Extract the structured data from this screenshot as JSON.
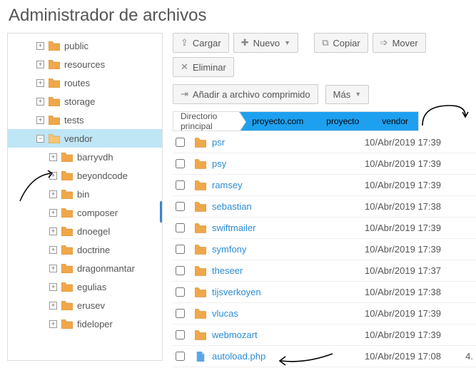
{
  "title": "Administrador de archivos",
  "toolbar": {
    "upload": "Cargar",
    "new": "Nuevo",
    "copy": "Copiar",
    "move": "Mover",
    "delete": "Eliminar",
    "compress": "Añadir a archivo comprimido",
    "more": "Más"
  },
  "breadcrumb": {
    "root": "Directorio principal",
    "segs": [
      "proyecto.com",
      "proyecto",
      "vendor"
    ]
  },
  "tree": [
    {
      "label": "public",
      "depth": 2,
      "expandable": true,
      "open": false,
      "selected": false
    },
    {
      "label": "resources",
      "depth": 2,
      "expandable": true,
      "open": false,
      "selected": false
    },
    {
      "label": "routes",
      "depth": 2,
      "expandable": true,
      "open": false,
      "selected": false
    },
    {
      "label": "storage",
      "depth": 2,
      "expandable": true,
      "open": false,
      "selected": false
    },
    {
      "label": "tests",
      "depth": 2,
      "expandable": true,
      "open": false,
      "selected": false
    },
    {
      "label": "vendor",
      "depth": 2,
      "expandable": true,
      "open": true,
      "selected": true
    },
    {
      "label": "barryvdh",
      "depth": 3,
      "expandable": true,
      "open": false,
      "selected": false
    },
    {
      "label": "beyondcode",
      "depth": 3,
      "expandable": true,
      "open": false,
      "selected": false
    },
    {
      "label": "bin",
      "depth": 3,
      "expandable": true,
      "open": false,
      "selected": false
    },
    {
      "label": "composer",
      "depth": 3,
      "expandable": true,
      "open": false,
      "selected": false
    },
    {
      "label": "dnoegel",
      "depth": 3,
      "expandable": true,
      "open": false,
      "selected": false
    },
    {
      "label": "doctrine",
      "depth": 3,
      "expandable": true,
      "open": false,
      "selected": false
    },
    {
      "label": "dragonmantar",
      "depth": 3,
      "expandable": true,
      "open": false,
      "selected": false
    },
    {
      "label": "egulias",
      "depth": 3,
      "expandable": true,
      "open": false,
      "selected": false
    },
    {
      "label": "erusev",
      "depth": 3,
      "expandable": true,
      "open": false,
      "selected": false
    },
    {
      "label": "fideloper",
      "depth": 3,
      "expandable": true,
      "open": false,
      "selected": false
    }
  ],
  "files": [
    {
      "name": "psr",
      "type": "folder",
      "date": "10/Abr/2019 17:39",
      "size": ""
    },
    {
      "name": "psy",
      "type": "folder",
      "date": "10/Abr/2019 17:39",
      "size": ""
    },
    {
      "name": "ramsey",
      "type": "folder",
      "date": "10/Abr/2019 17:39",
      "size": ""
    },
    {
      "name": "sebastian",
      "type": "folder",
      "date": "10/Abr/2019 17:38",
      "size": ""
    },
    {
      "name": "swiftmailer",
      "type": "folder",
      "date": "10/Abr/2019 17:39",
      "size": ""
    },
    {
      "name": "symfony",
      "type": "folder",
      "date": "10/Abr/2019 17:39",
      "size": ""
    },
    {
      "name": "theseer",
      "type": "folder",
      "date": "10/Abr/2019 17:37",
      "size": ""
    },
    {
      "name": "tijsverkoyen",
      "type": "folder",
      "date": "10/Abr/2019 17:38",
      "size": ""
    },
    {
      "name": "vlucas",
      "type": "folder",
      "date": "10/Abr/2019 17:39",
      "size": ""
    },
    {
      "name": "webmozart",
      "type": "folder",
      "date": "10/Abr/2019 17:39",
      "size": ""
    },
    {
      "name": "autoload.php",
      "type": "php",
      "date": "10/Abr/2019 17:08",
      "size": "4."
    }
  ],
  "icons": {
    "folder_closed_color": "#f0a749",
    "folder_open_color": "#f8c573",
    "php_color": "#58a6e8"
  }
}
